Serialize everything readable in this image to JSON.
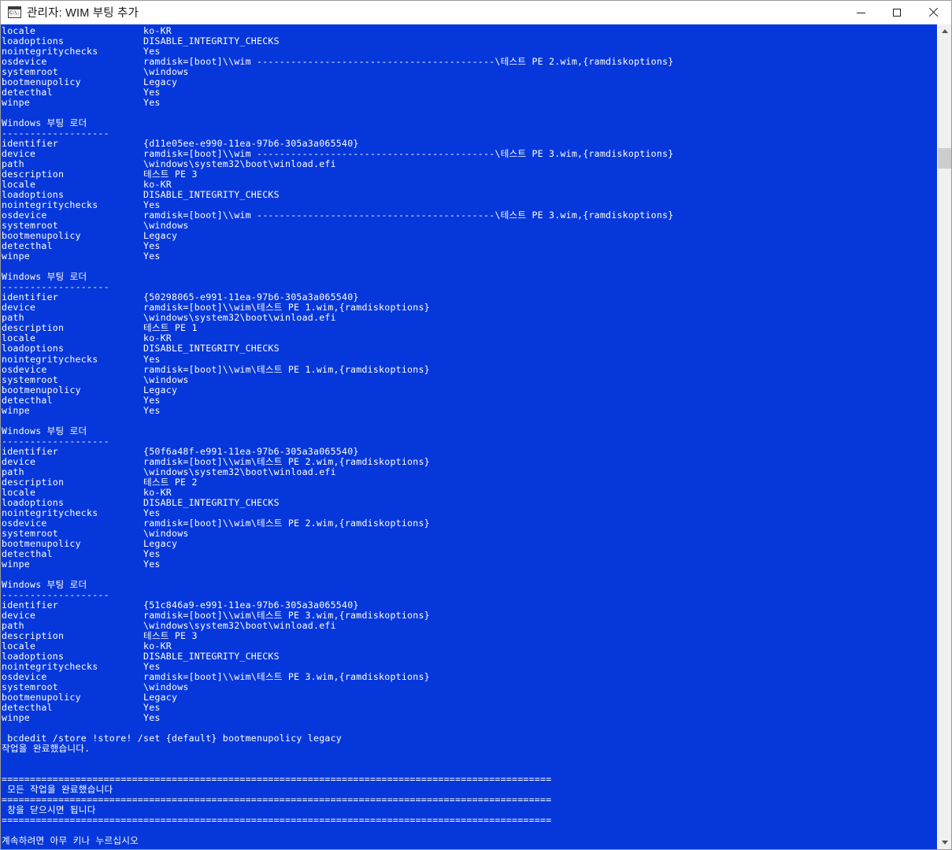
{
  "window": {
    "title": "관리자: WIM 부팅 추가",
    "icon": "console-icon",
    "controls": {
      "minimize_label": "최소화",
      "maximize_label": "최대화",
      "close_label": "닫기"
    },
    "background_color": "#0537db",
    "foreground_color": "#ffffff",
    "titlebar_color": "#ffffff"
  },
  "scrollbar": {
    "up_arrow": "▲",
    "down_arrow": "▼",
    "thumb_position_pct": 14,
    "thumb_size_pct": 2.5
  },
  "console": {
    "text": "locale                   ko-KR\nloadoptions              DISABLE_INTEGRITY_CHECKS\nnointegritychecks        Yes\nosdevice                 ramdisk=[boot]\\\\wim ------------------------------------------\\테스트 PE 2.wim,{ramdiskoptions}\nsystemroot               \\windows\nbootmenupolicy           Legacy\ndetecthal                Yes\nwinpe                    Yes\n\nWindows 부팅 로더\n-------------------\nidentifier               {d11e05ee-e990-11ea-97b6-305a3a065540}\ndevice                   ramdisk=[boot]\\\\wim ------------------------------------------\\테스트 PE 3.wim,{ramdiskoptions}\npath                     \\windows\\system32\\boot\\winload.efi\ndescription              테스트 PE 3\nlocale                   ko-KR\nloadoptions              DISABLE_INTEGRITY_CHECKS\nnointegritychecks        Yes\nosdevice                 ramdisk=[boot]\\\\wim ------------------------------------------\\테스트 PE 3.wim,{ramdiskoptions}\nsystemroot               \\windows\nbootmenupolicy           Legacy\ndetecthal                Yes\nwinpe                    Yes\n\nWindows 부팅 로더\n-------------------\nidentifier               {50298065-e991-11ea-97b6-305a3a065540}\ndevice                   ramdisk=[boot]\\\\wim\\테스트 PE 1.wim,{ramdiskoptions}\npath                     \\windows\\system32\\boot\\winload.efi\ndescription              테스트 PE 1\nlocale                   ko-KR\nloadoptions              DISABLE_INTEGRITY_CHECKS\nnointegritychecks        Yes\nosdevice                 ramdisk=[boot]\\\\wim\\테스트 PE 1.wim,{ramdiskoptions}\nsystemroot               \\windows\nbootmenupolicy           Legacy\ndetecthal                Yes\nwinpe                    Yes\n\nWindows 부팅 로더\n-------------------\nidentifier               {50f6a48f-e991-11ea-97b6-305a3a065540}\ndevice                   ramdisk=[boot]\\\\wim\\테스트 PE 2.wim,{ramdiskoptions}\npath                     \\windows\\system32\\boot\\winload.efi\ndescription              테스트 PE 2\nlocale                   ko-KR\nloadoptions              DISABLE_INTEGRITY_CHECKS\nnointegritychecks        Yes\nosdevice                 ramdisk=[boot]\\\\wim\\테스트 PE 2.wim,{ramdiskoptions}\nsystemroot               \\windows\nbootmenupolicy           Legacy\ndetecthal                Yes\nwinpe                    Yes\n\nWindows 부팅 로더\n-------------------\nidentifier               {51c846a9-e991-11ea-97b6-305a3a065540}\ndevice                   ramdisk=[boot]\\\\wim\\테스트 PE 3.wim,{ramdiskoptions}\npath                     \\windows\\system32\\boot\\winload.efi\ndescription              테스트 PE 3\nlocale                   ko-KR\nloadoptions              DISABLE_INTEGRITY_CHECKS\nnointegritychecks        Yes\nosdevice                 ramdisk=[boot]\\\\wim\\테스트 PE 3.wim,{ramdiskoptions}\nsystemroot               \\windows\nbootmenupolicy           Legacy\ndetecthal                Yes\nwinpe                    Yes\n\n bcdedit /store !store! /set {default} bootmenupolicy legacy\n작업을 완료했습니다.\n\n\n=================================================================================================\n 모든 작업을 완료했습니다\n=================================================================================================\n 창을 닫으시면 됩니다\n=================================================================================================\n\n계속하려면 아무 키나 누르십시오"
  },
  "console_sections": [
    {
      "heading": null,
      "rows": [
        {
          "key": "locale",
          "value": "ko-KR"
        },
        {
          "key": "loadoptions",
          "value": "DISABLE_INTEGRITY_CHECKS"
        },
        {
          "key": "nointegritychecks",
          "value": "Yes"
        },
        {
          "key": "osdevice",
          "value": "ramdisk=[boot]\\\\wim ------------------------------------------\\테스트 PE 2.wim,{ramdiskoptions}"
        },
        {
          "key": "systemroot",
          "value": "\\windows"
        },
        {
          "key": "bootmenupolicy",
          "value": "Legacy"
        },
        {
          "key": "detecthal",
          "value": "Yes"
        },
        {
          "key": "winpe",
          "value": "Yes"
        }
      ]
    },
    {
      "heading": "Windows 부팅 로더",
      "underline": "-------------------",
      "rows": [
        {
          "key": "identifier",
          "value": "{d11e05ee-e990-11ea-97b6-305a3a065540}"
        },
        {
          "key": "device",
          "value": "ramdisk=[boot]\\\\wim ------------------------------------------\\테스트 PE 3.wim,{ramdiskoptions}"
        },
        {
          "key": "path",
          "value": "\\windows\\system32\\boot\\winload.efi"
        },
        {
          "key": "description",
          "value": "테스트 PE 3"
        },
        {
          "key": "locale",
          "value": "ko-KR"
        },
        {
          "key": "loadoptions",
          "value": "DISABLE_INTEGRITY_CHECKS"
        },
        {
          "key": "nointegritychecks",
          "value": "Yes"
        },
        {
          "key": "osdevice",
          "value": "ramdisk=[boot]\\\\wim ------------------------------------------\\테스트 PE 3.wim,{ramdiskoptions}"
        },
        {
          "key": "systemroot",
          "value": "\\windows"
        },
        {
          "key": "bootmenupolicy",
          "value": "Legacy"
        },
        {
          "key": "detecthal",
          "value": "Yes"
        },
        {
          "key": "winpe",
          "value": "Yes"
        }
      ]
    },
    {
      "heading": "Windows 부팅 로더",
      "underline": "-------------------",
      "rows": [
        {
          "key": "identifier",
          "value": "{50298065-e991-11ea-97b6-305a3a065540}"
        },
        {
          "key": "device",
          "value": "ramdisk=[boot]\\\\wim\\테스트 PE 1.wim,{ramdiskoptions}"
        },
        {
          "key": "path",
          "value": "\\windows\\system32\\boot\\winload.efi"
        },
        {
          "key": "description",
          "value": "테스트 PE 1"
        },
        {
          "key": "locale",
          "value": "ko-KR"
        },
        {
          "key": "loadoptions",
          "value": "DISABLE_INTEGRITY_CHECKS"
        },
        {
          "key": "nointegritychecks",
          "value": "Yes"
        },
        {
          "key": "osdevice",
          "value": "ramdisk=[boot]\\\\wim\\테스트 PE 1.wim,{ramdiskoptions}"
        },
        {
          "key": "systemroot",
          "value": "\\windows"
        },
        {
          "key": "bootmenupolicy",
          "value": "Legacy"
        },
        {
          "key": "detecthal",
          "value": "Yes"
        },
        {
          "key": "winpe",
          "value": "Yes"
        }
      ]
    },
    {
      "heading": "Windows 부팅 로더",
      "underline": "-------------------",
      "rows": [
        {
          "key": "identifier",
          "value": "{50f6a48f-e991-11ea-97b6-305a3a065540}"
        },
        {
          "key": "device",
          "value": "ramdisk=[boot]\\\\wim\\테스트 PE 2.wim,{ramdiskoptions}"
        },
        {
          "key": "path",
          "value": "\\windows\\system32\\boot\\winload.efi"
        },
        {
          "key": "description",
          "value": "테스트 PE 2"
        },
        {
          "key": "locale",
          "value": "ko-KR"
        },
        {
          "key": "loadoptions",
          "value": "DISABLE_INTEGRITY_CHECKS"
        },
        {
          "key": "nointegritychecks",
          "value": "Yes"
        },
        {
          "key": "osdevice",
          "value": "ramdisk=[boot]\\\\wim\\테스트 PE 2.wim,{ramdiskoptions}"
        },
        {
          "key": "systemroot",
          "value": "\\windows"
        },
        {
          "key": "bootmenupolicy",
          "value": "Legacy"
        },
        {
          "key": "detecthal",
          "value": "Yes"
        },
        {
          "key": "winpe",
          "value": "Yes"
        }
      ]
    },
    {
      "heading": "Windows 부팅 로더",
      "underline": "-------------------",
      "rows": [
        {
          "key": "identifier",
          "value": "{51c846a9-e991-11ea-97b6-305a3a065540}"
        },
        {
          "key": "device",
          "value": "ramdisk=[boot]\\\\wim\\테스트 PE 3.wim,{ramdiskoptions}"
        },
        {
          "key": "path",
          "value": "\\windows\\system32\\boot\\winload.efi"
        },
        {
          "key": "description",
          "value": "테스트 PE 3"
        },
        {
          "key": "locale",
          "value": "ko-KR"
        },
        {
          "key": "loadoptions",
          "value": "DISABLE_INTEGRITY_CHECKS"
        },
        {
          "key": "nointegritychecks",
          "value": "Yes"
        },
        {
          "key": "osdevice",
          "value": "ramdisk=[boot]\\\\wim\\테스트 PE 3.wim,{ramdiskoptions}"
        },
        {
          "key": "systemroot",
          "value": "\\windows"
        },
        {
          "key": "bootmenupolicy",
          "value": "Legacy"
        },
        {
          "key": "detecthal",
          "value": "Yes"
        },
        {
          "key": "winpe",
          "value": "Yes"
        }
      ]
    }
  ],
  "footer": {
    "command": " bcdedit /store !store! /set {default} bootmenupolicy legacy",
    "command_result": "작업을 완료했습니다.",
    "separator": "=================================================================================================",
    "message_1": " 모든 작업을 완료했습니다",
    "message_2": " 창을 닫으시면 됩니다",
    "prompt": "계속하려면 아무 키나 누르십시오"
  }
}
